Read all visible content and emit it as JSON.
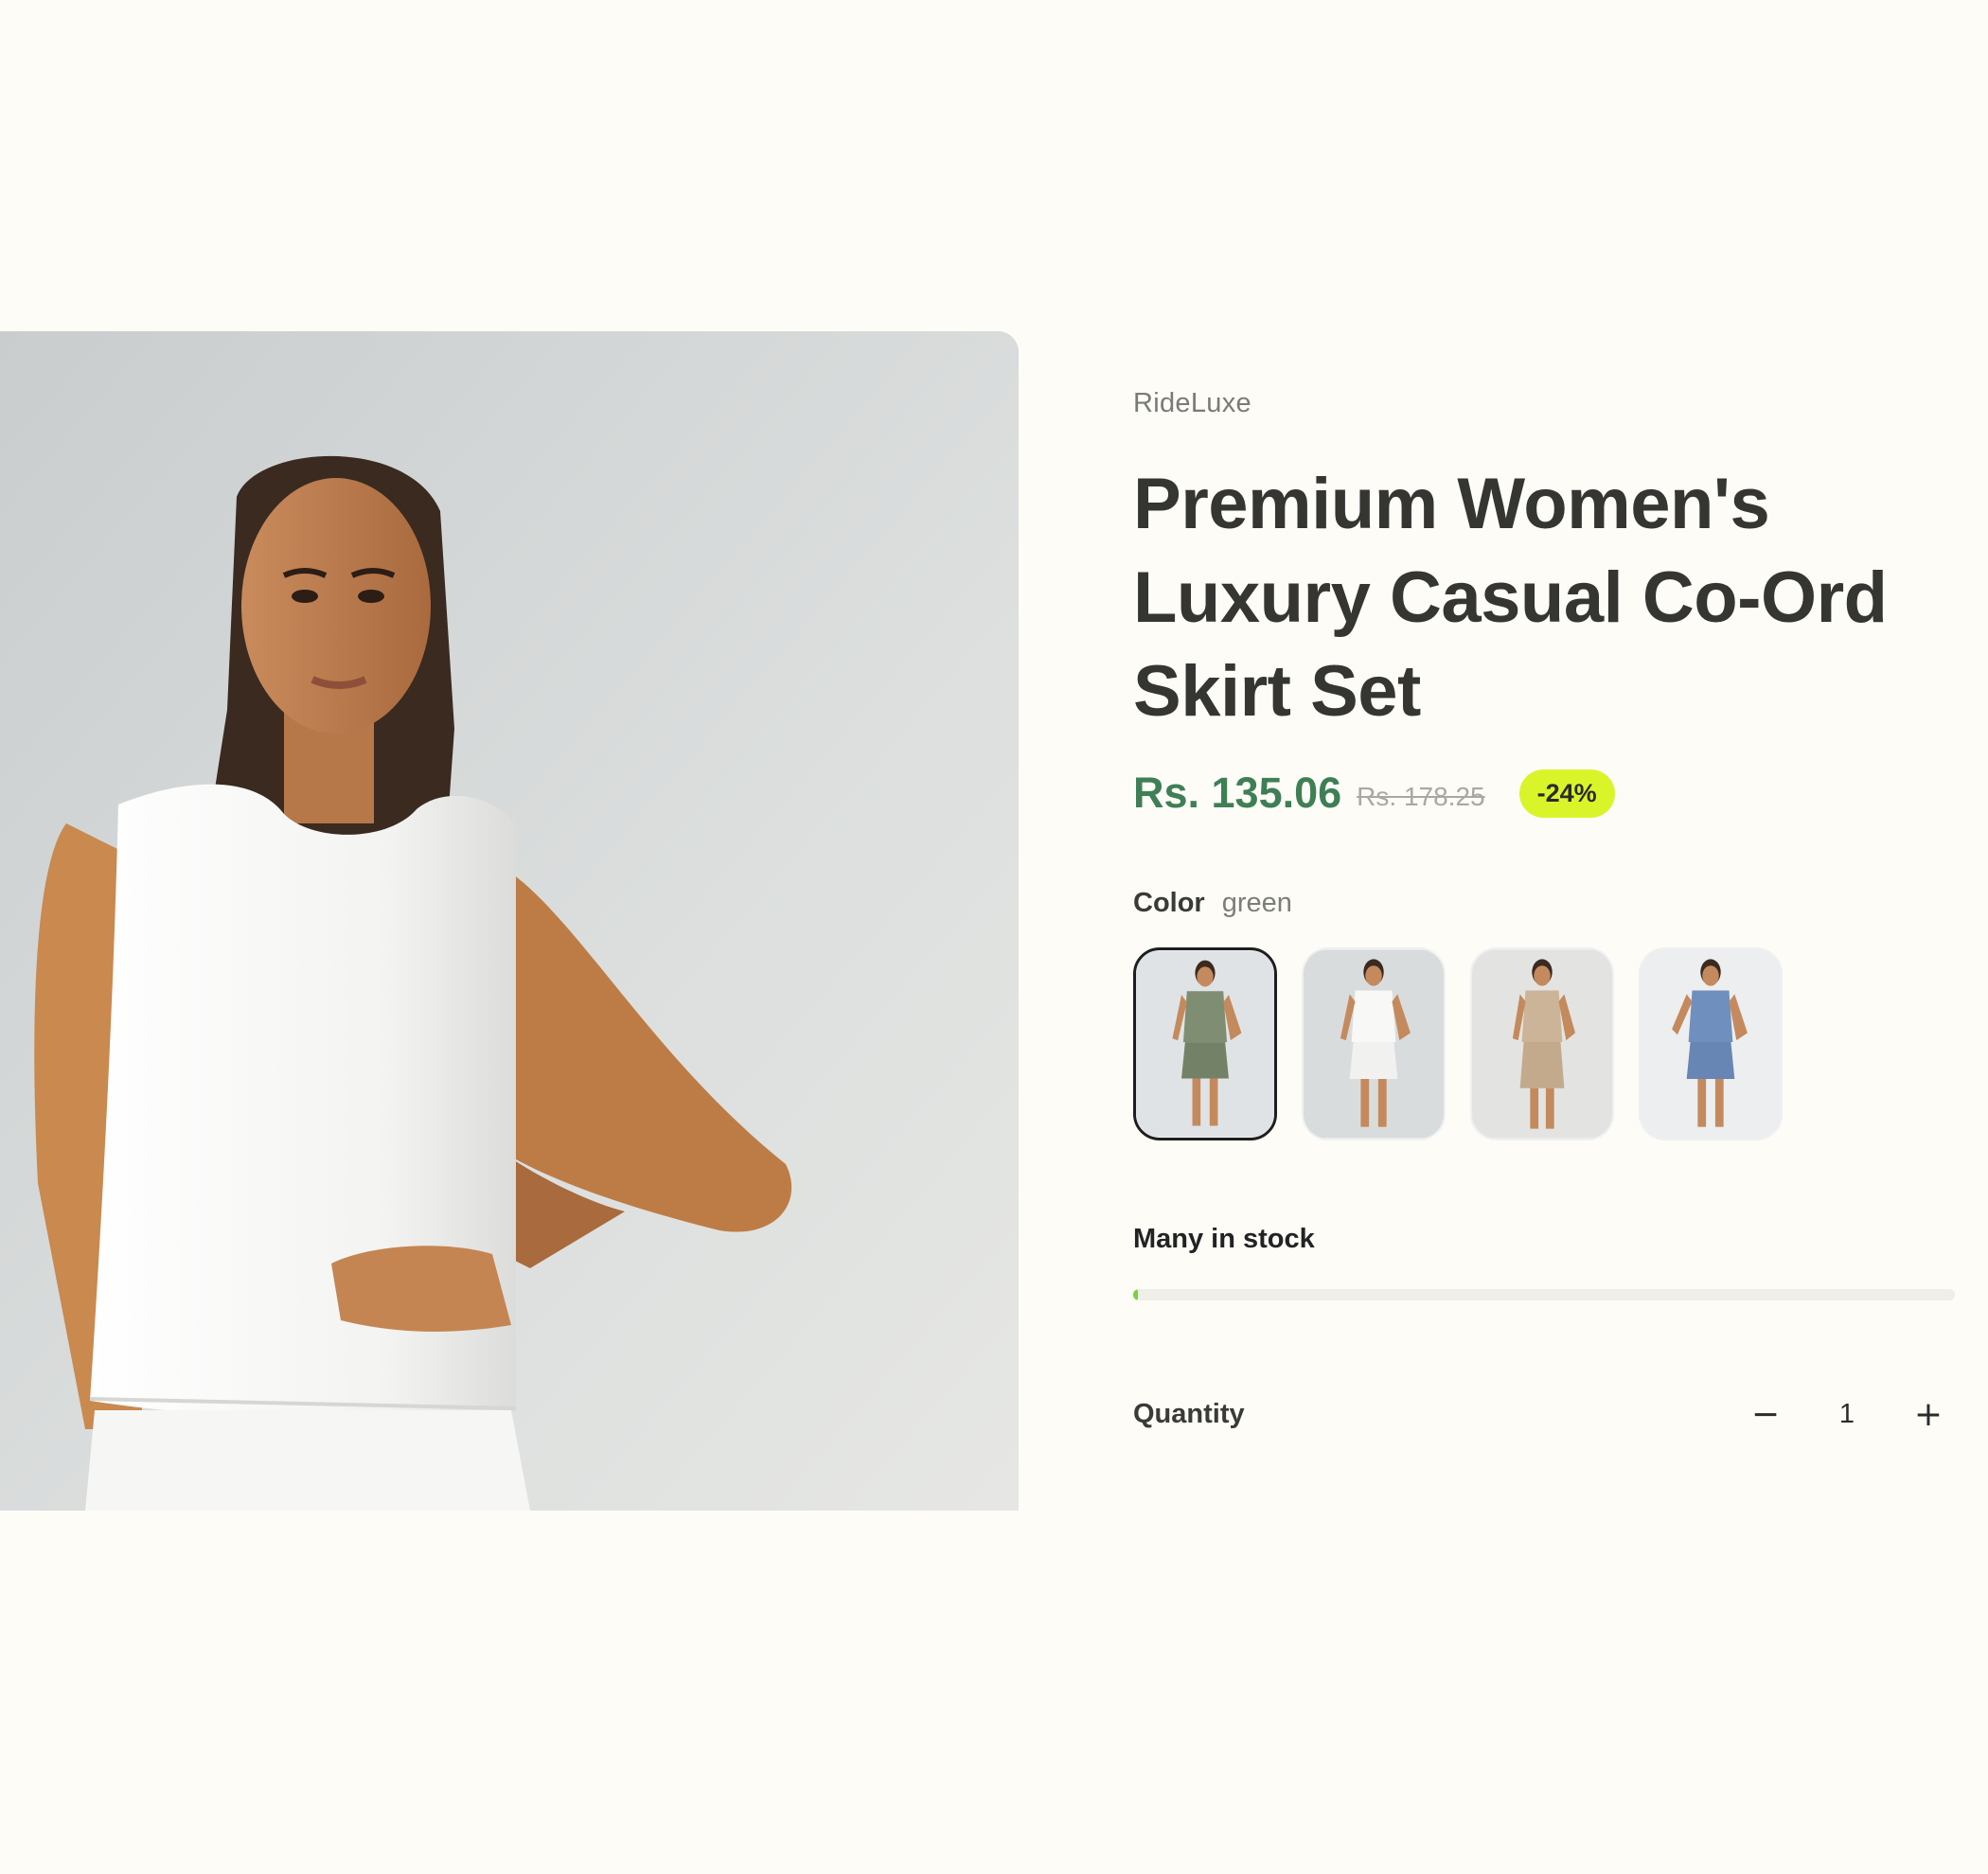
{
  "product": {
    "brand": "RideLuxe",
    "title": "Premium Women's Luxury Casual Co-Ord Skirt Set",
    "price": "Rs. 135.06",
    "compare_price": "Rs. 178.25",
    "discount_badge": "-24%",
    "color_label": "Color",
    "color_value": "green"
  },
  "variants": [
    {
      "name": "green",
      "selected": true,
      "color": "#7f8d72"
    },
    {
      "name": "white",
      "selected": false,
      "color": "#f4f4f2"
    },
    {
      "name": "beige",
      "selected": false,
      "color": "#cbb498"
    },
    {
      "name": "blue",
      "selected": false,
      "color": "#6f8fbe"
    }
  ],
  "stock": {
    "label": "Many in stock",
    "level_fraction": 0.006,
    "accent": "#79d33a"
  },
  "quantity": {
    "label": "Quantity",
    "value": "1",
    "decrement_icon": "minus-icon",
    "increment_icon": "plus-icon"
  },
  "colors": {
    "background": "#fdfcf7",
    "price": "#3f7f56",
    "badge": "#d9f52a"
  }
}
